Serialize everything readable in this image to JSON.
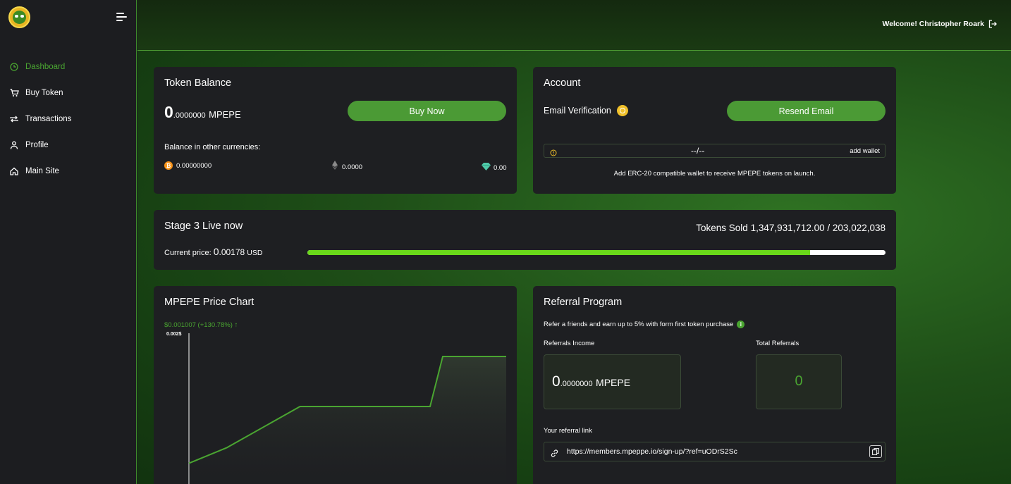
{
  "sidebar": {
    "items": [
      {
        "label": "Dashboard",
        "icon": "clock-icon",
        "active": true
      },
      {
        "label": "Buy Token",
        "icon": "cart-icon"
      },
      {
        "label": "Transactions",
        "icon": "repeat-icon"
      },
      {
        "label": "Profile",
        "icon": "user-icon"
      },
      {
        "label": "Main Site",
        "icon": "home-icon"
      }
    ]
  },
  "header": {
    "welcome": "Welcome! Christopher Roark"
  },
  "token_balance": {
    "title": "Token Balance",
    "amount_int": "0",
    "amount_dec": ".0000000",
    "unit": "MPEPE",
    "buy_label": "Buy Now",
    "other_label": "Balance in other currencies:",
    "btc": "0.00000000",
    "eth": "0.0000",
    "usdt": "0.00"
  },
  "account": {
    "title": "Account",
    "email_label": "Email Verification",
    "resend_label": "Resend Email",
    "wallet_value": "--/--",
    "add_wallet_label": "add wallet",
    "note": "Add ERC-20 compatible wallet to receive MPEPE tokens on launch."
  },
  "stage": {
    "title": "Stage 3 Live now",
    "price_label": "Current price:",
    "price_int": "0",
    "price_dec": ".00178",
    "price_unit": "USD",
    "sold_label": "Tokens Sold",
    "sold_value": "1,347,931,712.00 / 203,022,038",
    "progress": 0.87
  },
  "price_chart": {
    "title": "MPEPE Price Chart",
    "change": "$0.001007 (+130.78%)",
    "arrow": "↑",
    "ytick": "0.002$"
  },
  "chart_data": {
    "type": "line",
    "title": "MPEPE Price Chart",
    "ylabel": "",
    "series": [
      {
        "x": [
          0,
          0.12,
          0.35,
          0.76,
          0.8,
          0.82,
          1.0
        ],
        "y": [
          0.00057,
          0.00078,
          0.00133,
          0.00133,
          0.002,
          0.002,
          0.002
        ]
      }
    ],
    "ylim": [
      0,
      0.002
    ],
    "yticks": [
      "0.002$"
    ],
    "grid": false,
    "color": "#4aa531"
  },
  "referral": {
    "title": "Referral Program",
    "subtitle": "Refer a friends and earn up to 5% with form first token purchase",
    "income_label": "Referrals Income",
    "income_int": "0",
    "income_dec": ".0000000",
    "income_unit": "MPEPE",
    "total_label": "Total Referrals",
    "total_value": "0",
    "link_label": "Your referral link",
    "link": "https://members.mpeppe.io/sign-up/?ref=uODrS2Sc"
  },
  "colors": {
    "accent": "#4b9a35",
    "progress": "#6ad81a",
    "warning": "#f0c02a"
  }
}
